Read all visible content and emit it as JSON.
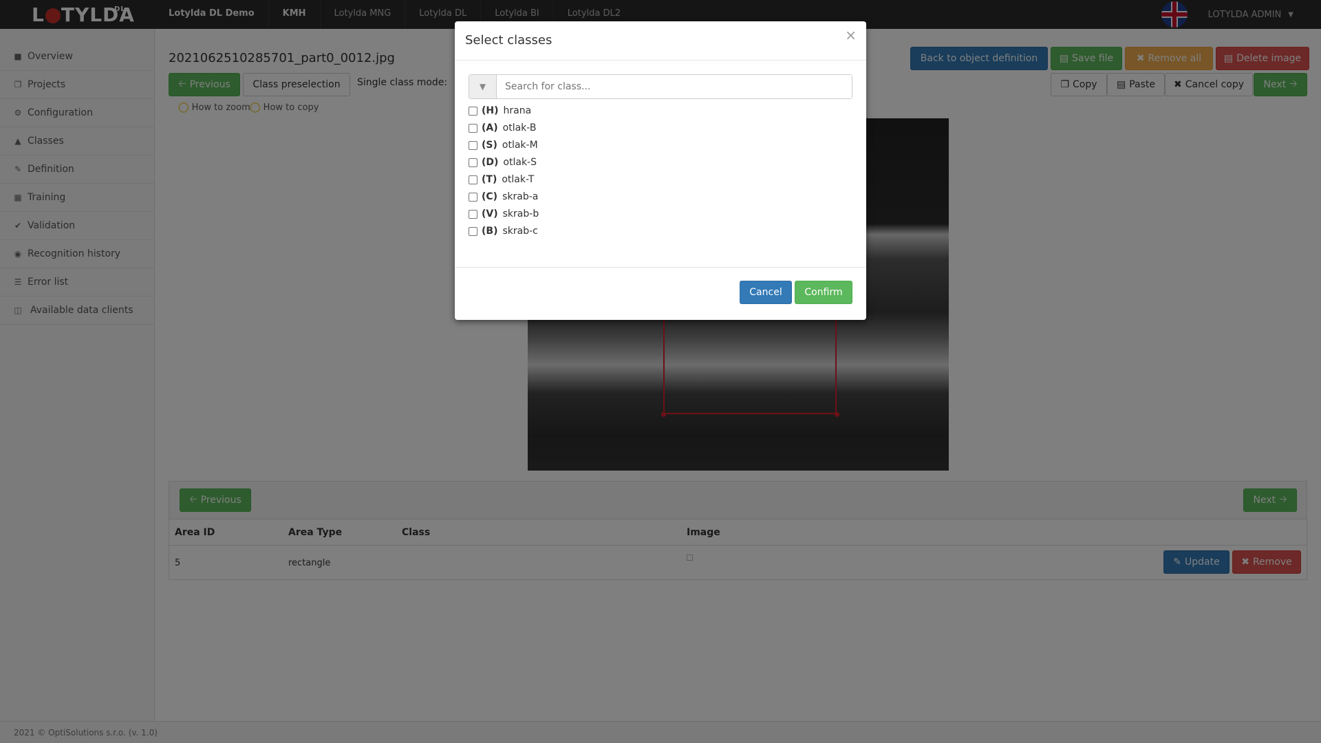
{
  "app": {
    "logo_text": "LOTYLDA",
    "logo_sup": "DL"
  },
  "topnav": {
    "items": [
      {
        "label": "Lotylda DL Demo"
      },
      {
        "label": "KMH"
      },
      {
        "label": "Lotylda MNG"
      },
      {
        "label": "Lotylda DL"
      },
      {
        "label": "Lotylda BI"
      },
      {
        "label": "Lotylda DL2"
      }
    ],
    "user": "LOTYLDA ADMIN"
  },
  "sidebar": {
    "items": [
      {
        "label": "Overview",
        "icon": "folder-icon"
      },
      {
        "label": "Projects",
        "icon": "copy-icon"
      },
      {
        "label": "Configuration",
        "icon": "gears-icon"
      },
      {
        "label": "Classes",
        "icon": "cube-icon"
      },
      {
        "label": "Definition",
        "icon": "pencil-icon"
      },
      {
        "label": "Training",
        "icon": "grid-icon"
      },
      {
        "label": "Validation",
        "icon": "check-icon"
      },
      {
        "label": "Recognition history",
        "icon": "eye-icon"
      },
      {
        "label": "Error list",
        "icon": "list-icon"
      },
      {
        "label": "Available data clients",
        "icon": "database-icon"
      }
    ]
  },
  "main": {
    "filename": "2021062510285701_part0_0012.jpg",
    "previous": "Previous",
    "class_preselection": "Class preselection",
    "single_class_mode": "Single class mode:",
    "how_to_zoom": "How to zoom",
    "how_to_copy": "How to copy",
    "back_to_definition": "Back to object definition",
    "save_file": "Save file",
    "remove_all": "Remove all",
    "delete_image": "Delete image",
    "copy": "Copy",
    "paste": "Paste",
    "cancel_copy": "Cancel copy",
    "next": "Next"
  },
  "table": {
    "previous": "Previous",
    "next": "Next",
    "headers": [
      "Area ID",
      "Area Type",
      "Class",
      "Image"
    ],
    "rows": [
      {
        "area_id": "5",
        "area_type": "rectangle",
        "class": ""
      }
    ],
    "update": "Update",
    "remove": "Remove"
  },
  "footer": {
    "text": "2021 © OptiSolutions s.r.o. (v. 1.0)"
  },
  "modal": {
    "title": "Select classes",
    "close": "×",
    "search_placeholder": "Search for class...",
    "classes": [
      {
        "shortcut": "(H)",
        "name": "hrana",
        "checked": false
      },
      {
        "shortcut": "(A)",
        "name": "otlak-B",
        "checked": false
      },
      {
        "shortcut": "(S)",
        "name": "otlak-M",
        "checked": false
      },
      {
        "shortcut": "(D)",
        "name": "otlak-S",
        "checked": false
      },
      {
        "shortcut": "(T)",
        "name": "otlak-T",
        "checked": false
      },
      {
        "shortcut": "(C)",
        "name": "skrab-a",
        "checked": false
      },
      {
        "shortcut": "(V)",
        "name": "skrab-b",
        "checked": false
      },
      {
        "shortcut": "(B)",
        "name": "skrab-c",
        "checked": false
      }
    ],
    "cancel": "Cancel",
    "confirm": "Confirm"
  },
  "colors": {
    "success": "#5cb85c",
    "primary": "#337ab7",
    "warning": "#f0ad4e",
    "danger": "#d9534f",
    "selection": "#d9232e"
  }
}
